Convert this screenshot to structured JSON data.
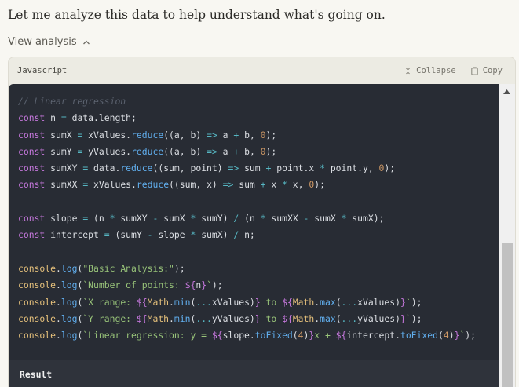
{
  "message": {
    "intro": "Let me analyze this data to help understand what's going on."
  },
  "analysis": {
    "toggle_label": "View analysis",
    "language": "Javascript",
    "collapse_label": "Collapse",
    "copy_label": "Copy",
    "result_label": "Result"
  },
  "code": [
    [
      {
        "t": "// Linear regression",
        "c": "com"
      }
    ],
    [
      {
        "t": "const",
        "c": "kw"
      },
      {
        "t": " n "
      },
      {
        "t": "=",
        "c": "op"
      },
      {
        "t": " data.length;"
      }
    ],
    [
      {
        "t": "const",
        "c": "kw"
      },
      {
        "t": " sumX "
      },
      {
        "t": "=",
        "c": "op"
      },
      {
        "t": " xValues."
      },
      {
        "t": "reduce",
        "c": "fn"
      },
      {
        "t": "((a, b) "
      },
      {
        "t": "=>",
        "c": "op"
      },
      {
        "t": " a "
      },
      {
        "t": "+",
        "c": "op"
      },
      {
        "t": " b, "
      },
      {
        "t": "0",
        "c": "num"
      },
      {
        "t": ");"
      }
    ],
    [
      {
        "t": "const",
        "c": "kw"
      },
      {
        "t": " sumY "
      },
      {
        "t": "=",
        "c": "op"
      },
      {
        "t": " yValues."
      },
      {
        "t": "reduce",
        "c": "fn"
      },
      {
        "t": "((a, b) "
      },
      {
        "t": "=>",
        "c": "op"
      },
      {
        "t": " a "
      },
      {
        "t": "+",
        "c": "op"
      },
      {
        "t": " b, "
      },
      {
        "t": "0",
        "c": "num"
      },
      {
        "t": ");"
      }
    ],
    [
      {
        "t": "const",
        "c": "kw"
      },
      {
        "t": " sumXY "
      },
      {
        "t": "=",
        "c": "op"
      },
      {
        "t": " data."
      },
      {
        "t": "reduce",
        "c": "fn"
      },
      {
        "t": "((sum, point) "
      },
      {
        "t": "=>",
        "c": "op"
      },
      {
        "t": " sum "
      },
      {
        "t": "+",
        "c": "op"
      },
      {
        "t": " point.x "
      },
      {
        "t": "*",
        "c": "op"
      },
      {
        "t": " point.y, "
      },
      {
        "t": "0",
        "c": "num"
      },
      {
        "t": ");"
      }
    ],
    [
      {
        "t": "const",
        "c": "kw"
      },
      {
        "t": " sumXX "
      },
      {
        "t": "=",
        "c": "op"
      },
      {
        "t": " xValues."
      },
      {
        "t": "reduce",
        "c": "fn"
      },
      {
        "t": "((sum, x) "
      },
      {
        "t": "=>",
        "c": "op"
      },
      {
        "t": " sum "
      },
      {
        "t": "+",
        "c": "op"
      },
      {
        "t": " x "
      },
      {
        "t": "*",
        "c": "op"
      },
      {
        "t": " x, "
      },
      {
        "t": "0",
        "c": "num"
      },
      {
        "t": ");"
      }
    ],
    [],
    [
      {
        "t": "const",
        "c": "kw"
      },
      {
        "t": " slope "
      },
      {
        "t": "=",
        "c": "op"
      },
      {
        "t": " (n "
      },
      {
        "t": "*",
        "c": "op"
      },
      {
        "t": " sumXY "
      },
      {
        "t": "-",
        "c": "op"
      },
      {
        "t": " sumX "
      },
      {
        "t": "*",
        "c": "op"
      },
      {
        "t": " sumY) "
      },
      {
        "t": "/",
        "c": "op"
      },
      {
        "t": " (n "
      },
      {
        "t": "*",
        "c": "op"
      },
      {
        "t": " sumXX "
      },
      {
        "t": "-",
        "c": "op"
      },
      {
        "t": " sumX "
      },
      {
        "t": "*",
        "c": "op"
      },
      {
        "t": " sumX);"
      }
    ],
    [
      {
        "t": "const",
        "c": "kw"
      },
      {
        "t": " intercept "
      },
      {
        "t": "=",
        "c": "op"
      },
      {
        "t": " (sumY "
      },
      {
        "t": "-",
        "c": "op"
      },
      {
        "t": " slope "
      },
      {
        "t": "*",
        "c": "op"
      },
      {
        "t": " sumX) "
      },
      {
        "t": "/",
        "c": "op"
      },
      {
        "t": " n;"
      }
    ],
    [],
    [
      {
        "t": "console",
        "c": "log"
      },
      {
        "t": "."
      },
      {
        "t": "log",
        "c": "fn"
      },
      {
        "t": "("
      },
      {
        "t": "\"Basic Analysis:\"",
        "c": "str"
      },
      {
        "t": ");"
      }
    ],
    [
      {
        "t": "console",
        "c": "log"
      },
      {
        "t": "."
      },
      {
        "t": "log",
        "c": "fn"
      },
      {
        "t": "("
      },
      {
        "t": "`Number of points: ",
        "c": "str"
      },
      {
        "t": "${",
        "c": "kw"
      },
      {
        "t": "n"
      },
      {
        "t": "}",
        "c": "kw"
      },
      {
        "t": "`",
        "c": "str"
      },
      {
        "t": ");"
      }
    ],
    [
      {
        "t": "console",
        "c": "log"
      },
      {
        "t": "."
      },
      {
        "t": "log",
        "c": "fn"
      },
      {
        "t": "("
      },
      {
        "t": "`X range: ",
        "c": "str"
      },
      {
        "t": "${",
        "c": "kw"
      },
      {
        "t": "Math",
        "c": "log"
      },
      {
        "t": "."
      },
      {
        "t": "min",
        "c": "fn"
      },
      {
        "t": "("
      },
      {
        "t": "...",
        "c": "op"
      },
      {
        "t": "xValues)"
      },
      {
        "t": "}",
        "c": "kw"
      },
      {
        "t": " to ",
        "c": "str"
      },
      {
        "t": "${",
        "c": "kw"
      },
      {
        "t": "Math",
        "c": "log"
      },
      {
        "t": "."
      },
      {
        "t": "max",
        "c": "fn"
      },
      {
        "t": "("
      },
      {
        "t": "...",
        "c": "op"
      },
      {
        "t": "xValues)"
      },
      {
        "t": "}",
        "c": "kw"
      },
      {
        "t": "`",
        "c": "str"
      },
      {
        "t": ");"
      }
    ],
    [
      {
        "t": "console",
        "c": "log"
      },
      {
        "t": "."
      },
      {
        "t": "log",
        "c": "fn"
      },
      {
        "t": "("
      },
      {
        "t": "`Y range: ",
        "c": "str"
      },
      {
        "t": "${",
        "c": "kw"
      },
      {
        "t": "Math",
        "c": "log"
      },
      {
        "t": "."
      },
      {
        "t": "min",
        "c": "fn"
      },
      {
        "t": "("
      },
      {
        "t": "...",
        "c": "op"
      },
      {
        "t": "yValues)"
      },
      {
        "t": "}",
        "c": "kw"
      },
      {
        "t": " to ",
        "c": "str"
      },
      {
        "t": "${",
        "c": "kw"
      },
      {
        "t": "Math",
        "c": "log"
      },
      {
        "t": "."
      },
      {
        "t": "max",
        "c": "fn"
      },
      {
        "t": "("
      },
      {
        "t": "...",
        "c": "op"
      },
      {
        "t": "yValues)"
      },
      {
        "t": "}",
        "c": "kw"
      },
      {
        "t": "`",
        "c": "str"
      },
      {
        "t": ");"
      }
    ],
    [
      {
        "t": "console",
        "c": "log"
      },
      {
        "t": "."
      },
      {
        "t": "log",
        "c": "fn"
      },
      {
        "t": "("
      },
      {
        "t": "`Linear regression: y = ",
        "c": "str"
      },
      {
        "t": "${",
        "c": "kw"
      },
      {
        "t": "slope."
      },
      {
        "t": "toFixed",
        "c": "fn"
      },
      {
        "t": "("
      },
      {
        "t": "4",
        "c": "num"
      },
      {
        "t": ")"
      },
      {
        "t": "}",
        "c": "kw"
      },
      {
        "t": "x + ",
        "c": "str"
      },
      {
        "t": "${",
        "c": "kw"
      },
      {
        "t": "intercept."
      },
      {
        "t": "toFixed",
        "c": "fn"
      },
      {
        "t": "("
      },
      {
        "t": "4",
        "c": "num"
      },
      {
        "t": ")"
      },
      {
        "t": "}",
        "c": "kw"
      },
      {
        "t": "`",
        "c": "str"
      },
      {
        "t": ");"
      }
    ]
  ]
}
